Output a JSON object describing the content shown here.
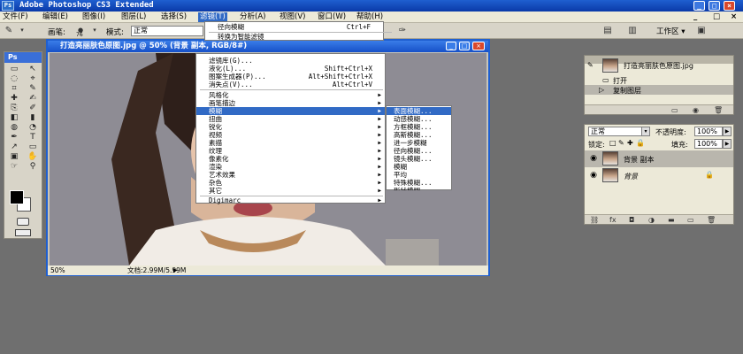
{
  "app": {
    "title": "Adobe Photoshop CS3 Extended",
    "ps_badge": "Ps",
    "window_buttons": [
      "_",
      "□",
      "×"
    ]
  },
  "menubar": [
    "文件(F)",
    "编辑(E)",
    "图像(I)",
    "图层(L)",
    "选择(S)",
    "滤镜(T)",
    "分析(A)",
    "视图(V)",
    "窗口(W)",
    "帮助(H)"
  ],
  "options": {
    "brush_label": "画笔:",
    "brush_size": "76",
    "mode_label": "模式:",
    "mode_value": "正常",
    "workspace_label": "工作区 ▾"
  },
  "toolbox": {
    "header": "Ps",
    "tools": [
      "▭",
      "↖",
      "◌",
      "⌖",
      "⌗",
      "✎",
      "✚",
      "✍",
      "⎘",
      "✐",
      "◧",
      "▮",
      "◍",
      "◔",
      "✒",
      "T",
      "↗",
      "▭",
      "▣",
      "✋",
      "☞",
      "⚲"
    ]
  },
  "filter_menu": {
    "items": [
      {
        "label": "径向模糊",
        "shortcut": "Ctrl+F"
      },
      {
        "label": "转换为智能滤镜",
        "shortcut": ""
      }
    ]
  },
  "filter_submenu": {
    "top": [
      {
        "label": "滤镜库(G)...",
        "shortcut": ""
      },
      {
        "label": "液化(L)...",
        "shortcut": "Shift+Ctrl+X"
      },
      {
        "label": "图案生成器(P)...",
        "shortcut": "Alt+Shift+Ctrl+X"
      },
      {
        "label": "消失点(V)...",
        "shortcut": "Alt+Ctrl+V"
      }
    ],
    "categories": [
      "风格化",
      "画笔描边",
      "模糊",
      "扭曲",
      "锐化",
      "视频",
      "素描",
      "纹理",
      "像素化",
      "渲染",
      "艺术效果",
      "杂色",
      "其它"
    ],
    "highlighted": "模糊",
    "bottom": [
      "Digimarc"
    ]
  },
  "blur_menu": {
    "items": [
      "表面模糊...",
      "动感模糊...",
      "方框模糊...",
      "高斯模糊...",
      "进一步模糊",
      "径向模糊...",
      "镜头模糊...",
      "模糊",
      "平均",
      "特殊模糊...",
      "形状模糊..."
    ],
    "highlighted": "表面模糊..."
  },
  "document": {
    "title": "打造亮丽肤色原图.jpg @ 50% (背景 副本, RGB/8#)",
    "zoom": "50%",
    "doc_info": "文档:2.99M/5.99M"
  },
  "history_panel": {
    "snapshot": "打造亮丽肤色原图.jpg",
    "items": [
      "打开",
      "复制图层"
    ],
    "selected": "复制图层"
  },
  "layers_panel": {
    "blend_mode": "正常",
    "opacity_label": "不透明度:",
    "opacity": "100%",
    "lock_label": "锁定:",
    "fill_label": "填充:",
    "fill": "100%",
    "layers": [
      {
        "name": "背景 副本",
        "selected": true
      },
      {
        "name": "背景",
        "selected": false
      }
    ]
  },
  "colors": {
    "titlebar": "#1f5fd0",
    "highlight": "#316ac5",
    "canvas_bg": "#8c8a92"
  }
}
